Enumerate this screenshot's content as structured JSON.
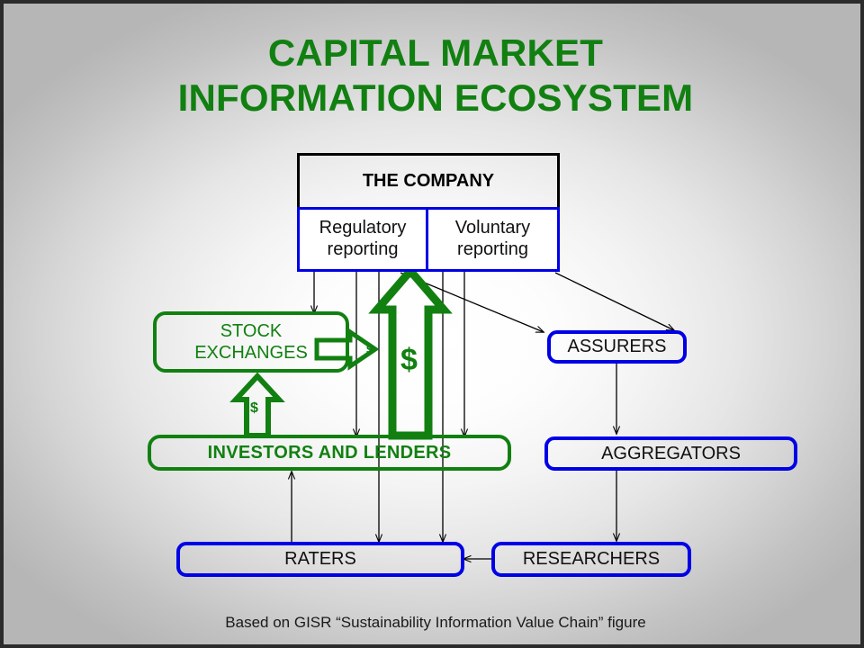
{
  "slide": {
    "title_line1": "CAPITAL MARKET",
    "title_line2": "INFORMATION ECOSYSTEM",
    "footer": "Based on GISR “Sustainability Information Value Chain” figure",
    "colors": {
      "green": "#118011",
      "blue": "#0000e6",
      "black": "#000000",
      "background_center": "#ffffff",
      "background_edge": "#b6b6b6"
    }
  },
  "nodes": {
    "company": {
      "label": "THE COMPANY",
      "border_color": "#000000",
      "text_color": "#000000"
    },
    "regulatory_reporting": {
      "line1": "Regulatory",
      "line2": "reporting",
      "border_color": "#0000e6"
    },
    "voluntary_reporting": {
      "line1": "Voluntary",
      "line2": "reporting",
      "border_color": "#0000e6"
    },
    "stock_exchanges": {
      "line1": "STOCK",
      "line2": "EXCHANGES",
      "border_color": "#118011",
      "text_color": "#118011"
    },
    "investors_and_lenders": {
      "label": "INVESTORS AND LENDERS",
      "border_color": "#118011",
      "text_color": "#118011"
    },
    "assurers": {
      "label": "ASSURERS",
      "border_color": "#0000e6"
    },
    "aggregators": {
      "label": "AGGREGATORS",
      "border_color": "#0000e6"
    },
    "raters": {
      "label": "RATERS",
      "border_color": "#0000e6"
    },
    "researchers": {
      "label": "RESEARCHERS",
      "border_color": "#0000e6"
    }
  },
  "money_flows": {
    "big_capital_symbol": "$",
    "exchange_fee_symbol": "$",
    "investor_to_exchange_symbol": "$"
  },
  "chart_data": {
    "type": "diagram",
    "title": "CAPITAL MARKET INFORMATION ECOSYSTEM",
    "nodes": [
      "THE COMPANY",
      "Regulatory reporting",
      "Voluntary reporting",
      "STOCK EXCHANGES",
      "ASSURERS",
      "INVESTORS AND LENDERS",
      "AGGREGATORS",
      "RATERS",
      "RESEARCHERS"
    ],
    "edges": [
      {
        "from": "Regulatory reporting",
        "to": "STOCK EXCHANGES",
        "style": "thin-black-arrow"
      },
      {
        "from": "Regulatory reporting",
        "to": "INVESTORS AND LENDERS",
        "style": "thin-black-arrow"
      },
      {
        "from": "Regulatory reporting",
        "to": "RATERS",
        "style": "thin-black-arrow"
      },
      {
        "from": "Regulatory reporting",
        "to": "ASSURERS",
        "style": "thin-black-diagonal-arrow"
      },
      {
        "from": "Voluntary reporting",
        "to": "INVESTORS AND LENDERS",
        "style": "thin-black-arrow"
      },
      {
        "from": "Voluntary reporting",
        "to": "RATERS",
        "style": "thin-black-arrow"
      },
      {
        "from": "Voluntary reporting",
        "to": "ASSURERS",
        "style": "thin-black-diagonal-arrow"
      },
      {
        "from": "ASSURERS",
        "to": "AGGREGATORS",
        "style": "thin-black-arrow"
      },
      {
        "from": "AGGREGATORS",
        "to": "RESEARCHERS",
        "style": "thin-black-arrow"
      },
      {
        "from": "RESEARCHERS",
        "to": "RATERS",
        "style": "thin-black-arrow"
      },
      {
        "from": "RATERS",
        "to": "INVESTORS AND LENDERS",
        "style": "thin-black-arrow"
      },
      {
        "from": "INVESTORS AND LENDERS",
        "to": "THE COMPANY",
        "label": "$",
        "style": "green-block-arrow"
      },
      {
        "from": "INVESTORS AND LENDERS",
        "to": "STOCK EXCHANGES",
        "label": "$",
        "style": "green-block-arrow"
      },
      {
        "from": "STOCK EXCHANGES",
        "to": "capital-flow",
        "label": "$",
        "style": "green-block-arrow"
      }
    ],
    "caption": "Based on GISR “Sustainability Information Value Chain” figure"
  }
}
